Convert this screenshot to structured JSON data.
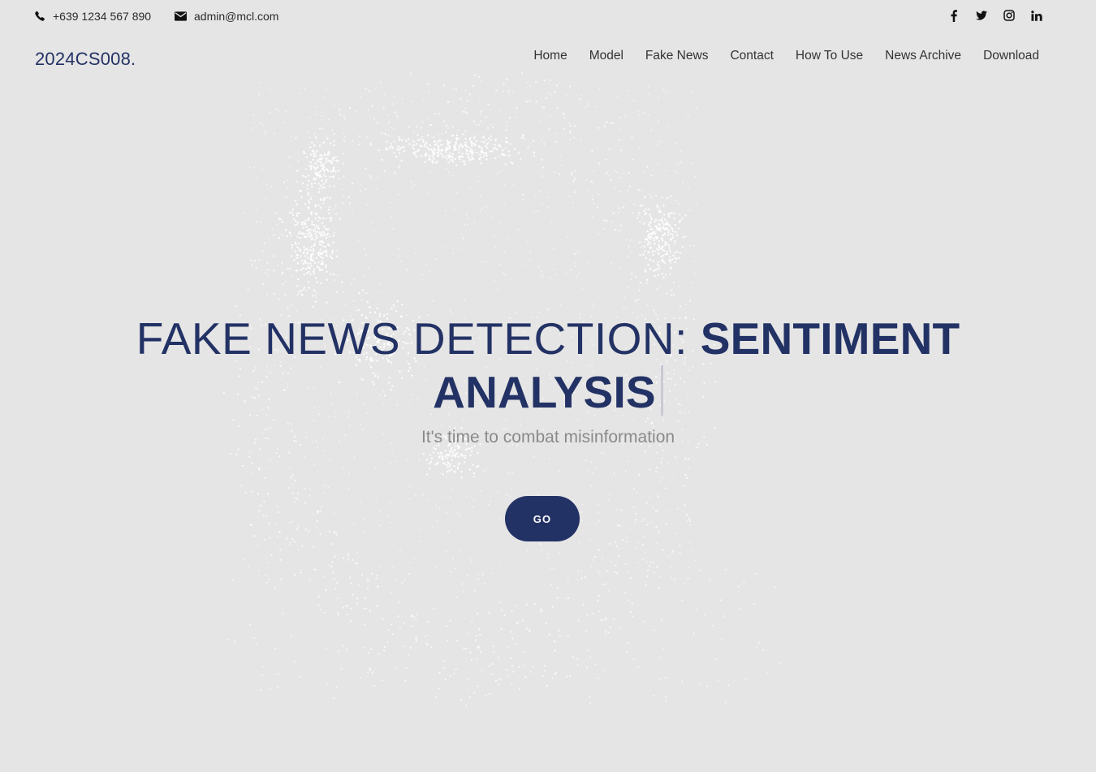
{
  "topbar": {
    "phone": "+639 1234 567 890",
    "email": "admin@mcl.com",
    "socials": [
      "facebook-icon",
      "twitter-icon",
      "instagram-icon",
      "linkedin-icon"
    ]
  },
  "brand": {
    "logo": "2024CS008."
  },
  "nav": {
    "items": [
      "Home",
      "Model",
      "Fake News",
      "Contact",
      "How To Use",
      "News Archive",
      "Download"
    ]
  },
  "hero": {
    "title_light": "FAKE NEWS DETECTION: ",
    "title_bold_1": "SENTIMENT",
    "title_bold_2": "ANALYSIS",
    "subtitle": "It's time to combat misinformation",
    "cta": "GO"
  },
  "colors": {
    "accent": "#233265",
    "background": "#e5e5e5",
    "particles": "#ffffff"
  }
}
